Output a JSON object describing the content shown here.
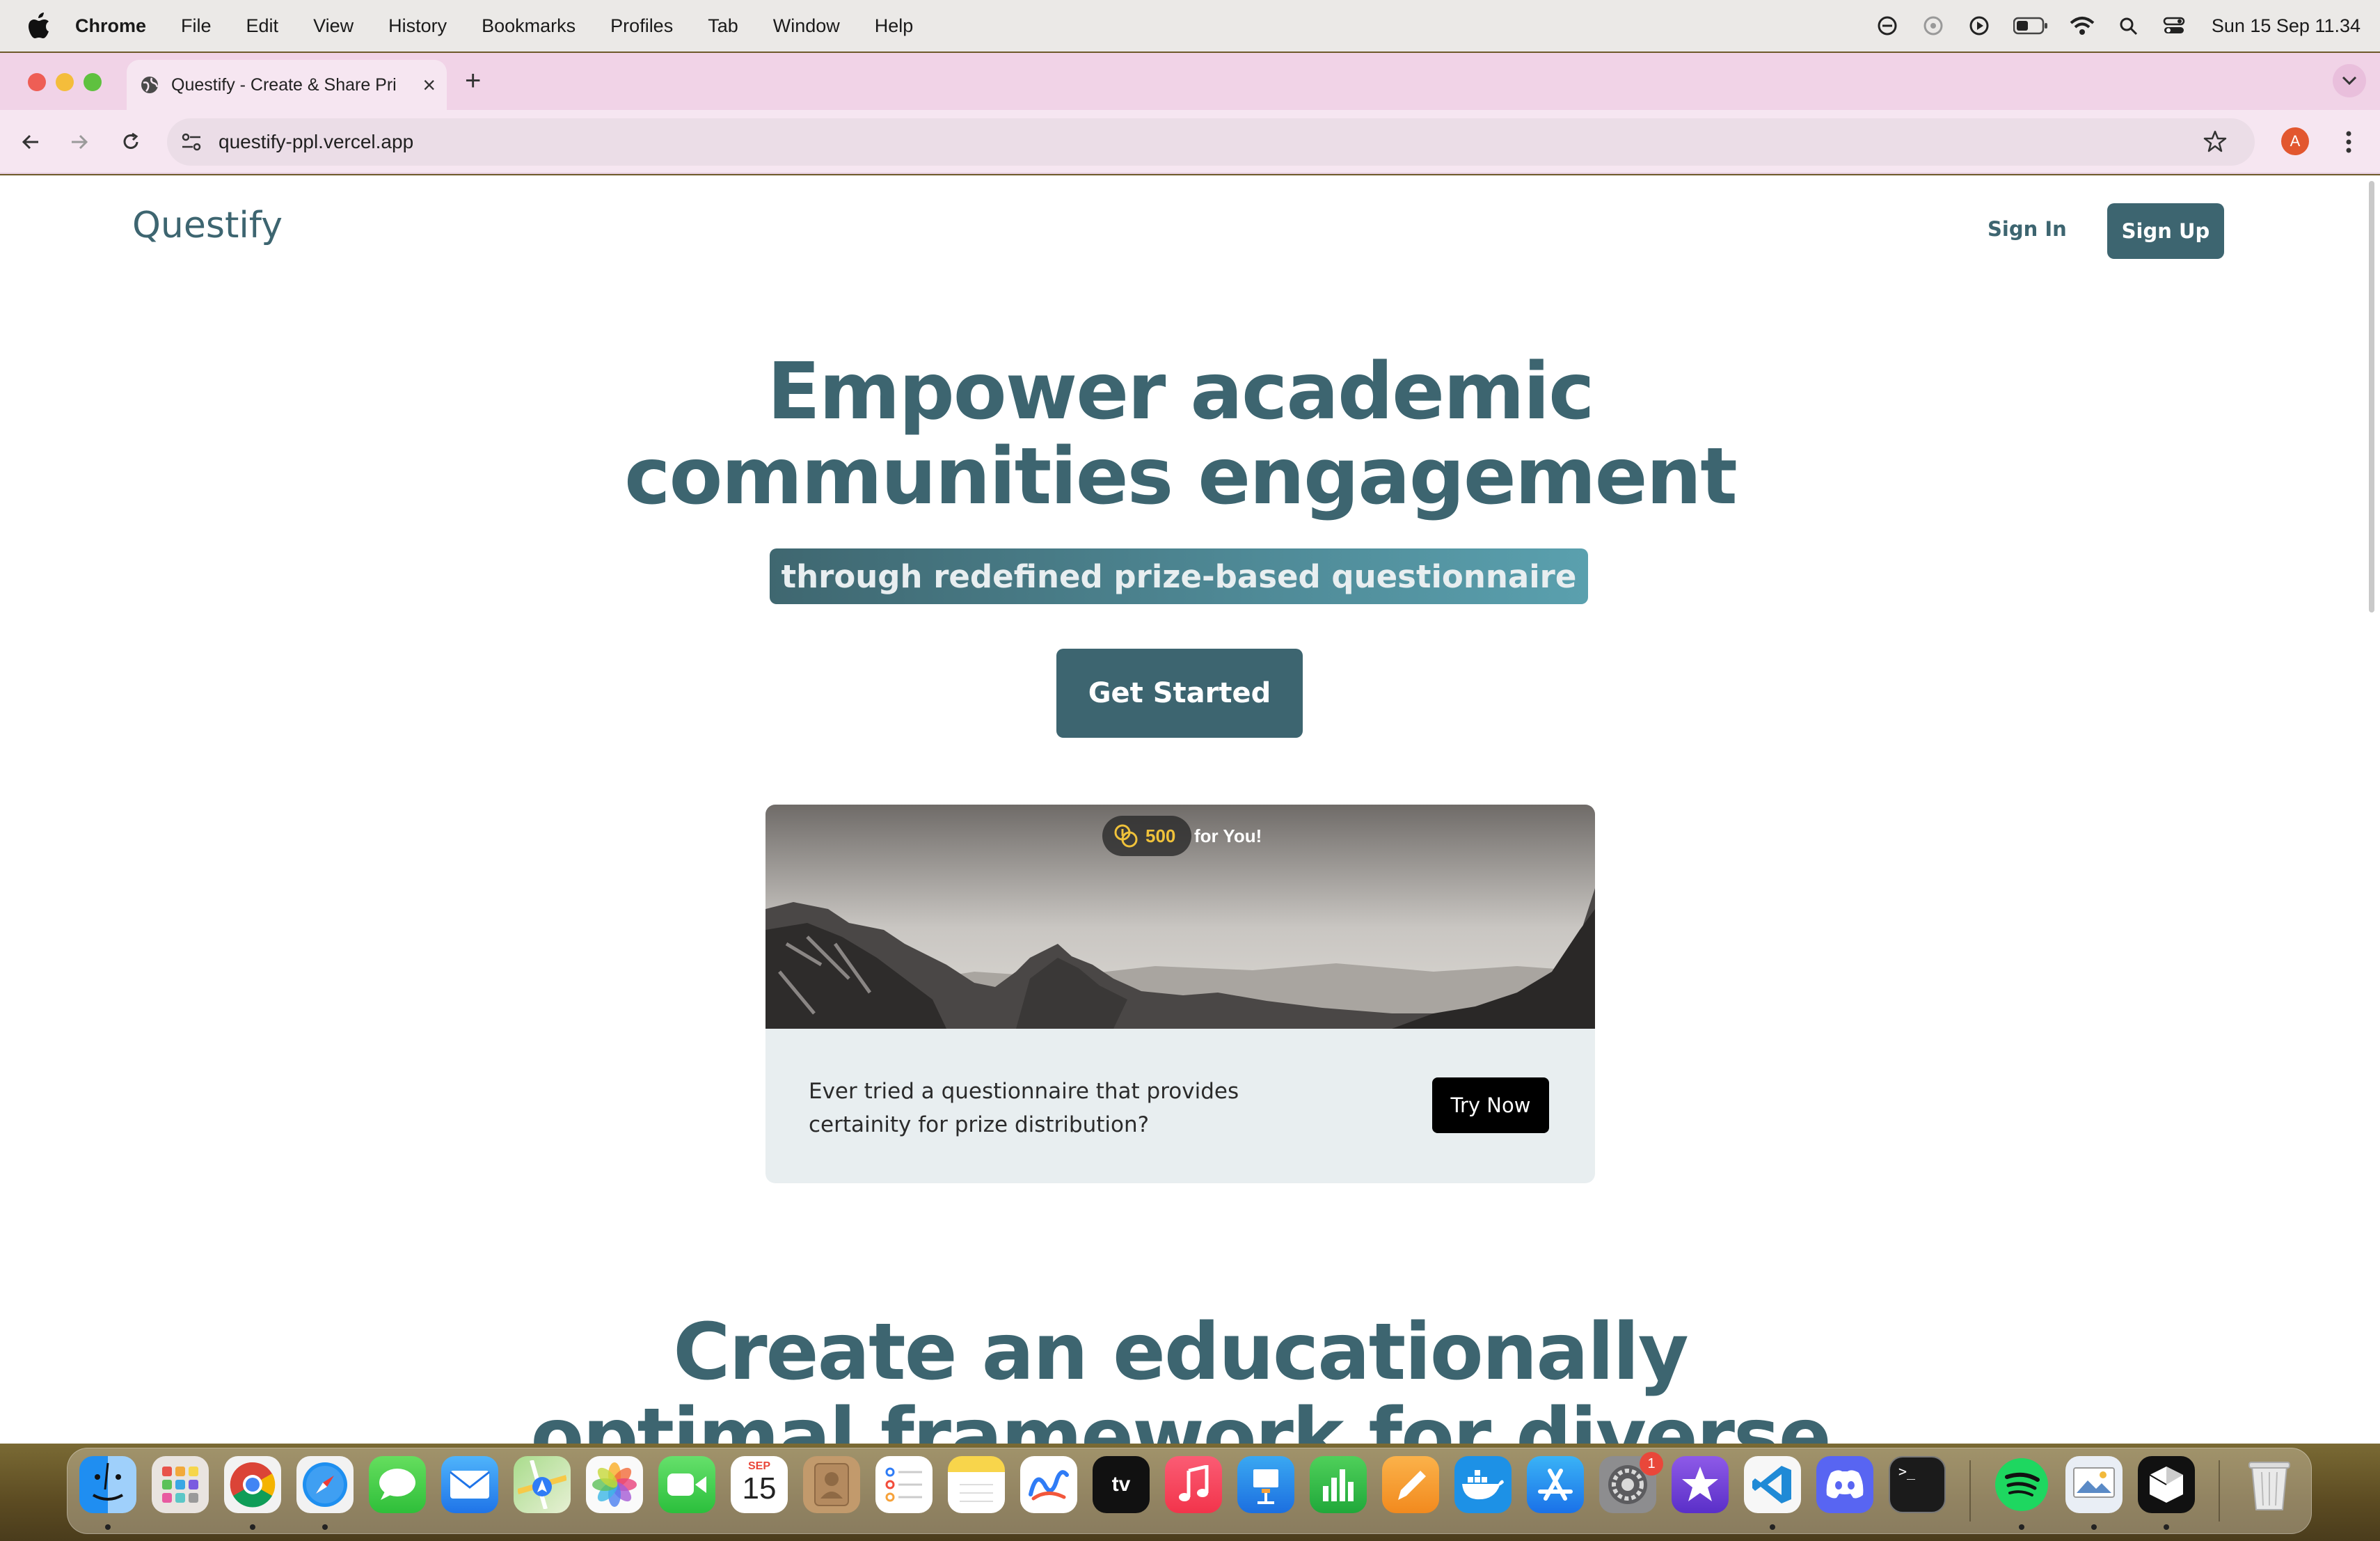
{
  "menubar": {
    "app_name": "Chrome",
    "items": [
      "File",
      "Edit",
      "View",
      "History",
      "Bookmarks",
      "Profiles",
      "Tab",
      "Window",
      "Help"
    ],
    "clock": "Sun 15 Sep  11.34"
  },
  "browser": {
    "tab_title": "Questify - Create & Share Pri",
    "url": "questify-ppl.vercel.app",
    "profile_initial": "A"
  },
  "page": {
    "logo": "Questify",
    "nav": {
      "sign_in": "Sign In",
      "sign_up": "Sign Up"
    },
    "hero": {
      "title_line1": "Empower academic",
      "title_line2": "communities engagement",
      "subtitle": "through redefined prize-based questionnaire",
      "cta": "Get Started"
    },
    "promo": {
      "prize_amount": "500",
      "prize_suffix": "for You!",
      "text": "Ever tried a questionnaire that provides certainity for prize distribution?",
      "button": "Try Now"
    },
    "section2": {
      "title_line1": "Create an educationally",
      "title_line2": "optimal framework for diverse"
    }
  },
  "dock": {
    "apps": [
      "Finder",
      "Launchpad",
      "Chrome",
      "Safari",
      "Messages",
      "Mail",
      "Maps",
      "Photos",
      "FaceTime",
      "Calendar",
      "Contacts",
      "Reminders",
      "Notes",
      "Freeform",
      "TV",
      "Music",
      "Keynote",
      "Numbers",
      "Pages",
      "Docker",
      "App Store",
      "System Settings",
      "iMovie",
      "VS Code",
      "Discord",
      "Terminal",
      "Spotify",
      "Preview",
      "Lookaway",
      "Trash"
    ],
    "calendar_month": "SEP",
    "calendar_day": "15",
    "settings_badge": "1"
  }
}
